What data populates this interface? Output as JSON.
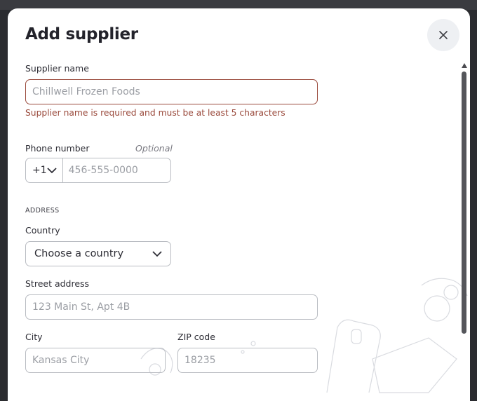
{
  "modal": {
    "title": "Add supplier",
    "close_icon": "close-icon"
  },
  "supplier": {
    "label": "Supplier name",
    "placeholder": "Chillwell Frozen Foods",
    "value": "",
    "error": "Supplier name is required and must be at least 5 characters"
  },
  "phone": {
    "label": "Phone number",
    "optional": "Optional",
    "dial_code": "+1",
    "placeholder": "456-555-0000"
  },
  "address": {
    "section_label": "ADDRESS",
    "country_label": "Country",
    "country_value": "Choose a country",
    "street_label": "Street address",
    "street_placeholder": "123 Main St, Apt 4B",
    "city_label": "City",
    "city_placeholder": "Kansas City",
    "zip_label": "ZIP code",
    "zip_placeholder": "18235"
  },
  "colors": {
    "error": "#9a4a3c",
    "border": "#b9bcc2",
    "text": "#2d2d35"
  }
}
